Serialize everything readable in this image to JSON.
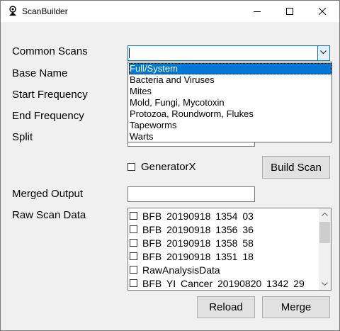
{
  "window": {
    "title": "ScanBuilder",
    "icons": [
      "app-icon",
      "minimize-icon",
      "maximize-icon",
      "close-icon"
    ]
  },
  "labels": {
    "common_scans": "Common Scans",
    "base_name": "Base Name",
    "start_frequency": "Start Frequency",
    "end_frequency": "End Frequency",
    "split": "Split",
    "merged_output": "Merged Output",
    "raw_scan_data": "Raw Scan Data"
  },
  "common_scans": {
    "value": "",
    "options": [
      "Full/System",
      "Bacteria and Viruses",
      "Mites",
      "Mold, Fungi, Mycotoxin",
      "Protozoa, Roundworm, Flukes",
      "Tapeworms",
      "Warts"
    ],
    "highlighted": "Full/System"
  },
  "fields": {
    "split": "",
    "merged_output": ""
  },
  "generatorx": {
    "label": "GeneratorX",
    "checked": false
  },
  "buttons": {
    "build_scan": "Build Scan",
    "reload": "Reload",
    "merge": "Merge"
  },
  "raw_scan_data": {
    "items": [
      {
        "label": "BFB  20190918  1354  03",
        "checked": false
      },
      {
        "label": "BFB  20190918  1356  36",
        "checked": false
      },
      {
        "label": "BFB  20190918  1358  58",
        "checked": false
      },
      {
        "label": "BFB  20190918  1351  18",
        "checked": false
      },
      {
        "label": "RawAnalysisData",
        "checked": false
      },
      {
        "label": "BFB  YI Cancer  20190820  1342  29",
        "checked": false
      }
    ]
  },
  "colors": {
    "accent": "#0078d7",
    "window_bg": "#f0f0f0"
  }
}
